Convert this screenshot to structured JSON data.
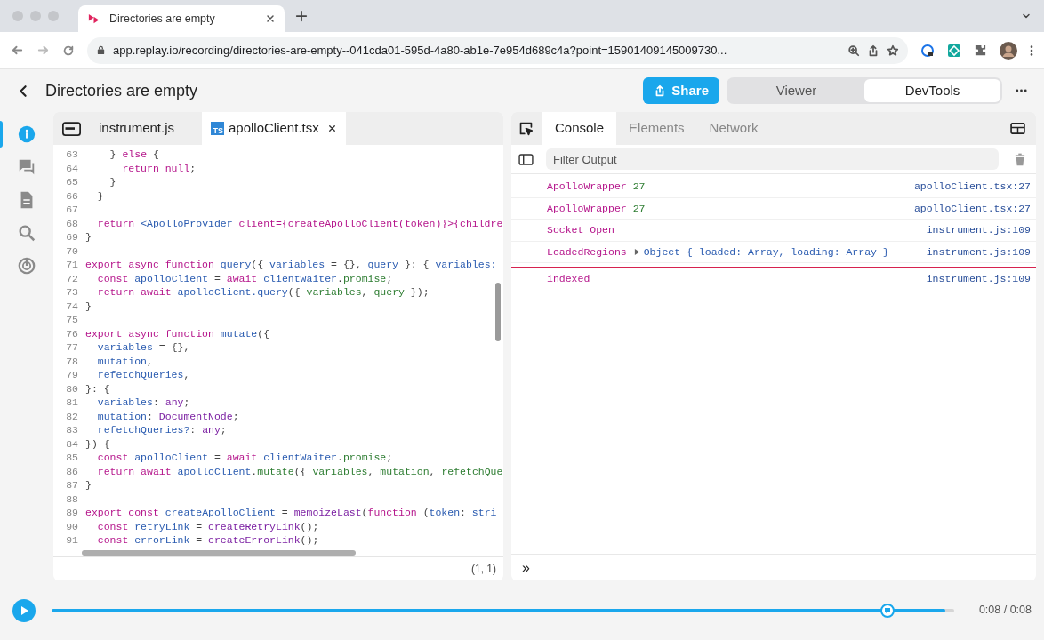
{
  "browser": {
    "tab_title": "Directories are empty",
    "url": "app.replay.io/recording/directories-are-empty--041cda01-595d-4a80-ab1e-7e954d689c4a?point=15901409145009730..."
  },
  "header": {
    "title": "Directories are empty",
    "share_label": "Share",
    "view_modes": [
      {
        "label": "Viewer",
        "selected": false
      },
      {
        "label": "DevTools",
        "selected": true
      }
    ]
  },
  "sidebar": {
    "items": [
      {
        "kind": "info",
        "selected": true
      },
      {
        "kind": "comments",
        "selected": false
      },
      {
        "kind": "document",
        "selected": false
      },
      {
        "kind": "search",
        "selected": false
      },
      {
        "kind": "replay",
        "selected": false
      }
    ]
  },
  "editor": {
    "tabs": [
      {
        "label": "instrument.js",
        "kind": "js",
        "selected": false
      },
      {
        "label": "apolloClient.tsx",
        "kind": "ts",
        "badge": "TS",
        "selected": true
      }
    ],
    "lines": [
      {
        "number": "63",
        "tokens": [
          {
            "kind": "plain",
            "text": "    } "
          },
          {
            "kind": "keyword",
            "text": "else"
          },
          {
            "kind": "plain",
            "text": " {"
          }
        ]
      },
      {
        "number": "64",
        "tokens": [
          {
            "kind": "keyword",
            "text": "      return null"
          },
          {
            "kind": "plain",
            "text": ";"
          }
        ]
      },
      {
        "number": "65",
        "tokens": [
          {
            "kind": "plain",
            "text": "    }"
          }
        ]
      },
      {
        "number": "66",
        "tokens": [
          {
            "kind": "plain",
            "text": "  }"
          }
        ]
      },
      {
        "number": "67"
      },
      {
        "number": "68",
        "tokens": [
          {
            "kind": "keyword",
            "text": "  return "
          },
          {
            "kind": "name",
            "text": "<ApolloProvider "
          },
          {
            "kind": "keyword",
            "text": "client={createApolloClient(token)}>{childre"
          }
        ]
      },
      {
        "number": "69",
        "tokens": [
          {
            "kind": "plain",
            "text": "}"
          }
        ]
      },
      {
        "number": "70"
      },
      {
        "number": "71",
        "tokens": [
          {
            "kind": "keyword",
            "text": "export async function "
          },
          {
            "kind": "name",
            "text": "query"
          },
          {
            "kind": "plain",
            "text": "({ "
          },
          {
            "kind": "name",
            "text": "variables"
          },
          {
            "kind": "plain",
            "text": " = {}, "
          },
          {
            "kind": "name",
            "text": "query"
          },
          {
            "kind": "plain",
            "text": " }: { "
          },
          {
            "kind": "name",
            "text": "variables:"
          }
        ]
      },
      {
        "number": "72",
        "tokens": [
          {
            "kind": "keyword",
            "text": "  const "
          },
          {
            "kind": "name",
            "text": "apolloClient"
          },
          {
            "kind": "plain",
            "text": " = "
          },
          {
            "kind": "keyword",
            "text": "await "
          },
          {
            "kind": "name",
            "text": "clientWaiter"
          },
          {
            "kind": "plain",
            "text": "."
          },
          {
            "kind": "property",
            "text": "promise"
          },
          {
            "kind": "plain",
            "text": ";"
          }
        ]
      },
      {
        "number": "73",
        "tokens": [
          {
            "kind": "keyword",
            "text": "  return await "
          },
          {
            "kind": "name",
            "text": "apolloClient.query"
          },
          {
            "kind": "plain",
            "text": "({ "
          },
          {
            "kind": "property",
            "text": "variables"
          },
          {
            "kind": "plain",
            "text": ", "
          },
          {
            "kind": "property",
            "text": "query"
          },
          {
            "kind": "plain",
            "text": " });"
          }
        ]
      },
      {
        "number": "74",
        "tokens": [
          {
            "kind": "plain",
            "text": "}"
          }
        ]
      },
      {
        "number": "75"
      },
      {
        "number": "76",
        "tokens": [
          {
            "kind": "keyword",
            "text": "export async function "
          },
          {
            "kind": "name",
            "text": "mutate"
          },
          {
            "kind": "plain",
            "text": "({"
          }
        ]
      },
      {
        "number": "77",
        "tokens": [
          {
            "kind": "name",
            "text": "  variables"
          },
          {
            "kind": "plain",
            "text": " = {},"
          }
        ]
      },
      {
        "number": "78",
        "tokens": [
          {
            "kind": "name",
            "text": "  mutation"
          },
          {
            "kind": "plain",
            "text": ","
          }
        ]
      },
      {
        "number": "79",
        "tokens": [
          {
            "kind": "name",
            "text": "  refetchQueries"
          },
          {
            "kind": "plain",
            "text": ","
          }
        ]
      },
      {
        "number": "80",
        "tokens": [
          {
            "kind": "plain",
            "text": "}: {"
          }
        ]
      },
      {
        "number": "81",
        "tokens": [
          {
            "kind": "name",
            "text": "  variables"
          },
          {
            "kind": "plain",
            "text": ": "
          },
          {
            "kind": "type",
            "text": "any"
          },
          {
            "kind": "plain",
            "text": ";"
          }
        ]
      },
      {
        "number": "82",
        "tokens": [
          {
            "kind": "name",
            "text": "  mutation"
          },
          {
            "kind": "plain",
            "text": ": "
          },
          {
            "kind": "type",
            "text": "DocumentNode"
          },
          {
            "kind": "plain",
            "text": ";"
          }
        ]
      },
      {
        "number": "83",
        "tokens": [
          {
            "kind": "name",
            "text": "  refetchQueries?"
          },
          {
            "kind": "plain",
            "text": ": "
          },
          {
            "kind": "type",
            "text": "any"
          },
          {
            "kind": "plain",
            "text": ";"
          }
        ]
      },
      {
        "number": "84",
        "tokens": [
          {
            "kind": "plain",
            "text": "}) {"
          }
        ]
      },
      {
        "number": "85",
        "tokens": [
          {
            "kind": "keyword",
            "text": "  const "
          },
          {
            "kind": "name",
            "text": "apolloClient"
          },
          {
            "kind": "plain",
            "text": " = "
          },
          {
            "kind": "keyword",
            "text": "await "
          },
          {
            "kind": "name",
            "text": "clientWaiter"
          },
          {
            "kind": "plain",
            "text": "."
          },
          {
            "kind": "property",
            "text": "promise"
          },
          {
            "kind": "plain",
            "text": ";"
          }
        ]
      },
      {
        "number": "86",
        "tokens": [
          {
            "kind": "keyword",
            "text": "  return await "
          },
          {
            "kind": "name",
            "text": "apolloClient"
          },
          {
            "kind": "plain",
            "text": "."
          },
          {
            "kind": "property",
            "text": "mutate"
          },
          {
            "kind": "plain",
            "text": "({ "
          },
          {
            "kind": "property",
            "text": "variables"
          },
          {
            "kind": "plain",
            "text": ", "
          },
          {
            "kind": "property",
            "text": "mutation"
          },
          {
            "kind": "plain",
            "text": ", "
          },
          {
            "kind": "property",
            "text": "refetchQue"
          }
        ]
      },
      {
        "number": "87",
        "tokens": [
          {
            "kind": "plain",
            "text": "}"
          }
        ]
      },
      {
        "number": "88"
      },
      {
        "number": "89",
        "tokens": [
          {
            "kind": "keyword",
            "text": "export const "
          },
          {
            "kind": "name",
            "text": "createApolloClient"
          },
          {
            "kind": "plain",
            "text": " = "
          },
          {
            "kind": "type",
            "text": "memoizeLast"
          },
          {
            "kind": "plain",
            "text": "("
          },
          {
            "kind": "keyword",
            "text": "function "
          },
          {
            "kind": "plain",
            "text": "("
          },
          {
            "kind": "name",
            "text": "token"
          },
          {
            "kind": "plain",
            "text": ": "
          },
          {
            "kind": "name",
            "text": "stri"
          }
        ]
      },
      {
        "number": "90",
        "tokens": [
          {
            "kind": "keyword",
            "text": "  const "
          },
          {
            "kind": "name",
            "text": "retryLink"
          },
          {
            "kind": "plain",
            "text": " = "
          },
          {
            "kind": "type",
            "text": "createRetryLink"
          },
          {
            "kind": "plain",
            "text": "();"
          }
        ]
      },
      {
        "number": "91",
        "tokens": [
          {
            "kind": "keyword",
            "text": "  const "
          },
          {
            "kind": "name",
            "text": "errorLink"
          },
          {
            "kind": "plain",
            "text": " = "
          },
          {
            "kind": "type",
            "text": "createErrorLink"
          },
          {
            "kind": "plain",
            "text": "();"
          }
        ]
      }
    ],
    "cursor_position": "(1, 1)"
  },
  "devtools": {
    "tabs": [
      {
        "label": "Console",
        "selected": true
      },
      {
        "label": "Elements",
        "selected": false
      },
      {
        "label": "Network",
        "selected": false
      }
    ],
    "filter": {
      "placeholder": "Filter Output"
    },
    "messages": [
      {
        "parts": [
          {
            "kind": "label",
            "text": "ApolloWrapper"
          },
          {
            "kind": "number",
            "text": "27"
          }
        ],
        "expandable": false,
        "source": "apolloClient.tsx:27",
        "paused_marker": false
      },
      {
        "parts": [
          {
            "kind": "label",
            "text": "ApolloWrapper"
          },
          {
            "kind": "number",
            "text": "27"
          }
        ],
        "expandable": false,
        "source": "apolloClient.tsx:27",
        "paused_marker": false
      },
      {
        "parts": [
          {
            "kind": "label",
            "text": "Socket Open"
          }
        ],
        "expandable": false,
        "source": "instrument.js:109",
        "paused_marker": false
      },
      {
        "parts": [
          {
            "kind": "label",
            "text": "LoadedRegions"
          },
          {
            "kind": "object",
            "text": "Object { loaded: Array, loading: Array }"
          }
        ],
        "expandable": true,
        "source": "instrument.js:109",
        "paused_marker": false
      },
      {
        "parts": [
          {
            "kind": "label",
            "text": "indexed"
          }
        ],
        "expandable": false,
        "source": "instrument.js:109",
        "paused_marker": true
      }
    ],
    "prompt": "»"
  },
  "timeline": {
    "level": 0.99,
    "time": "0:08 / 0:08"
  }
}
